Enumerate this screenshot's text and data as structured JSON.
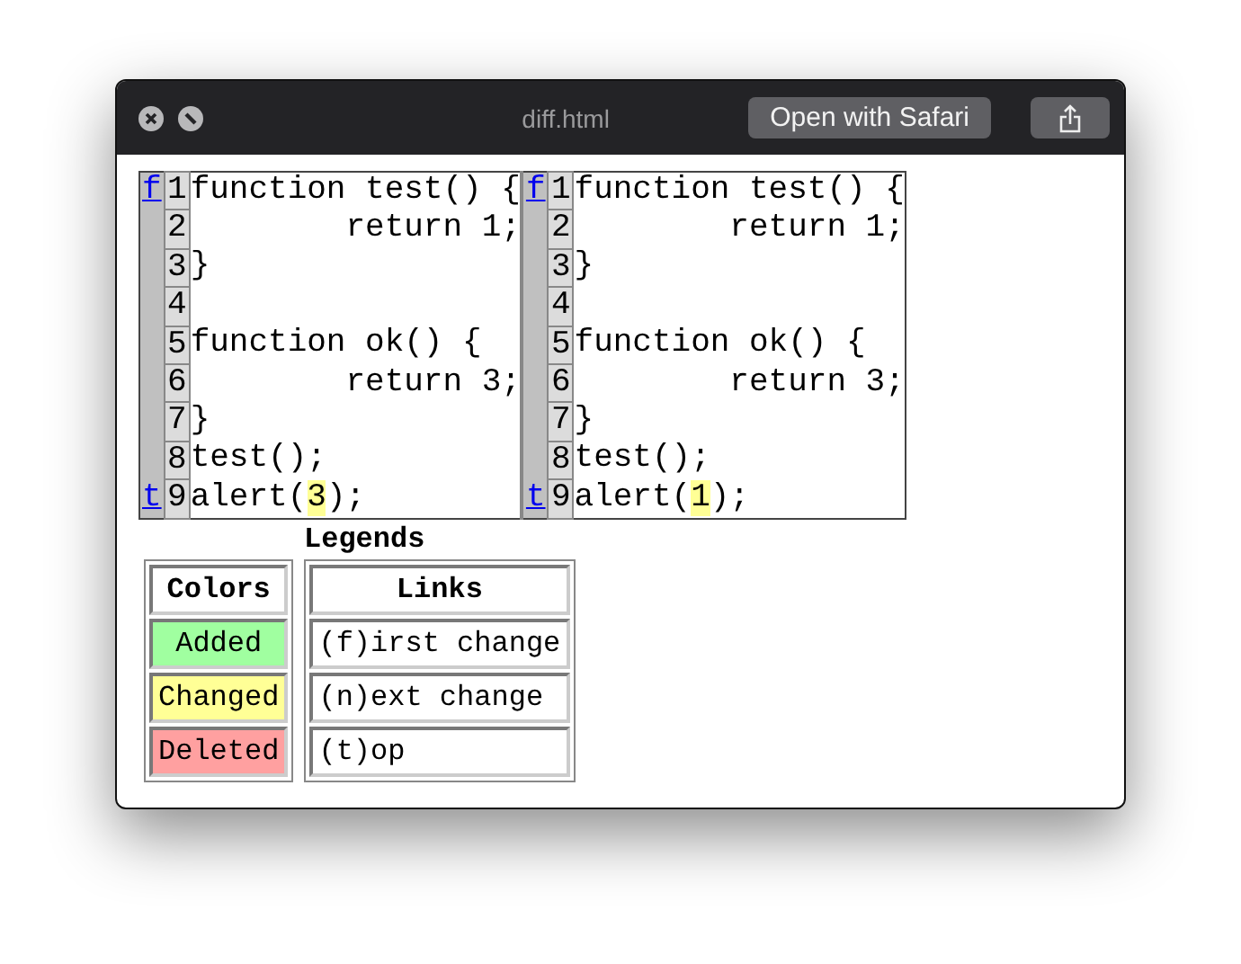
{
  "window": {
    "title": "diff.html",
    "open_button": "Open with Safari"
  },
  "diff": {
    "panes": [
      {
        "lines": [
          {
            "nav": "f",
            "number": "1",
            "parts": [
              {
                "text": "function test() {"
              }
            ]
          },
          {
            "number": "2",
            "parts": [
              {
                "text": "        return 1;"
              }
            ]
          },
          {
            "number": "3",
            "parts": [
              {
                "text": "}"
              }
            ]
          },
          {
            "number": "4"
          },
          {
            "number": "5",
            "parts": [
              {
                "text": "function ok() {"
              }
            ]
          },
          {
            "number": "6",
            "parts": [
              {
                "text": "        return 3;"
              }
            ]
          },
          {
            "number": "7",
            "parts": [
              {
                "text": "}"
              }
            ]
          },
          {
            "number": "8",
            "parts": [
              {
                "text": "test();"
              }
            ]
          },
          {
            "nav": "t",
            "number": "9",
            "parts": [
              {
                "text": "alert("
              },
              {
                "text": "3",
                "kind": "changed"
              },
              {
                "text": ");"
              }
            ]
          }
        ]
      },
      {
        "lines": [
          {
            "nav": "f",
            "number": "1",
            "parts": [
              {
                "text": "function test() {"
              }
            ]
          },
          {
            "number": "2",
            "parts": [
              {
                "text": "        return 1;"
              }
            ]
          },
          {
            "number": "3",
            "parts": [
              {
                "text": "}"
              }
            ]
          },
          {
            "number": "4"
          },
          {
            "number": "5",
            "parts": [
              {
                "text": "function ok() {"
              }
            ]
          },
          {
            "number": "6",
            "parts": [
              {
                "text": "        return 3;"
              }
            ]
          },
          {
            "number": "7",
            "parts": [
              {
                "text": "}"
              }
            ]
          },
          {
            "number": "8",
            "parts": [
              {
                "text": "test();"
              }
            ]
          },
          {
            "nav": "t",
            "number": "9",
            "parts": [
              {
                "text": "alert("
              },
              {
                "text": "1",
                "kind": "changed"
              },
              {
                "text": ");"
              }
            ]
          }
        ]
      }
    ]
  },
  "legend": {
    "title": "Legends",
    "colors": {
      "heading": "Colors",
      "items": [
        {
          "label": "Added",
          "color": "#a0ffa0"
        },
        {
          "label": "Changed",
          "color": "#ffff96"
        },
        {
          "label": "Deleted",
          "color": "#ffa0a0"
        }
      ]
    },
    "links": {
      "heading": "Links",
      "items": [
        "(f)irst change",
        "(n)ext change",
        "(t)op"
      ]
    }
  }
}
